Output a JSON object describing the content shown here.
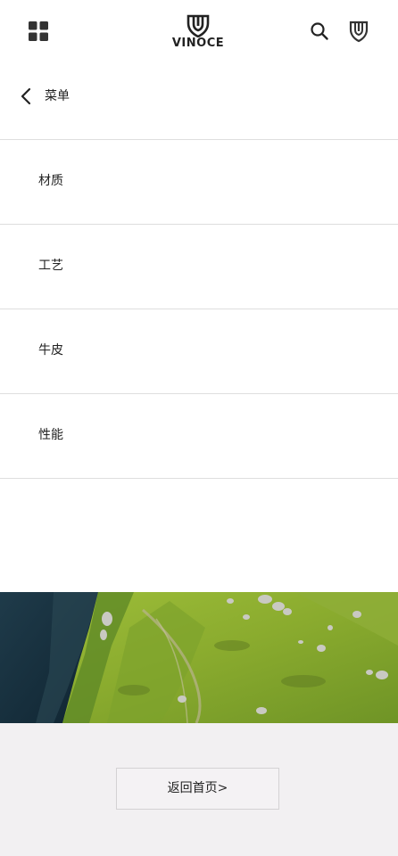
{
  "header": {
    "menu_icon": "grid-icon",
    "logo_text": "VINOCE",
    "search_icon": "search-icon",
    "account_icon": "shield-icon"
  },
  "menu": {
    "back_label": "菜单",
    "back_icon": "chevron-left-icon",
    "items": [
      {
        "label": "材质"
      },
      {
        "label": "工艺"
      },
      {
        "label": "牛皮"
      },
      {
        "label": "性能"
      }
    ]
  },
  "footer": {
    "home_button_label": "返回首页>"
  },
  "colors": {
    "divider": "#dedede",
    "footer_bg": "#f2f0f2",
    "text": "#222222"
  }
}
